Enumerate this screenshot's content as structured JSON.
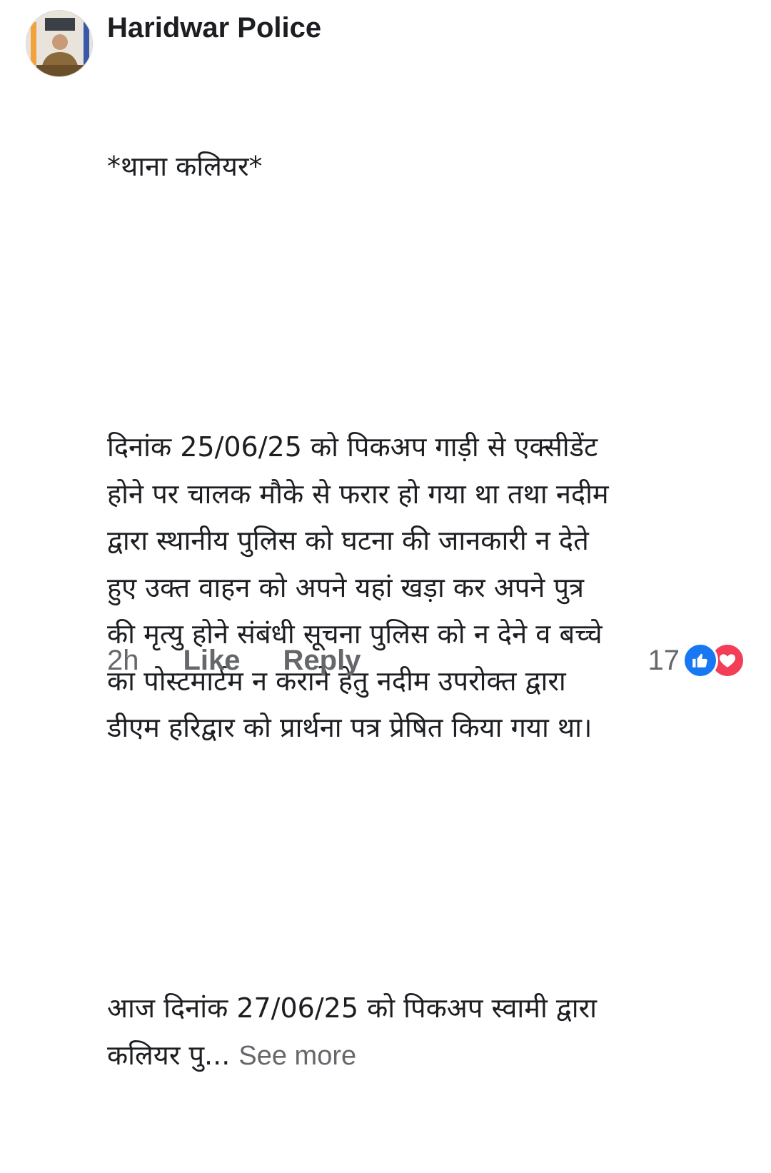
{
  "comment": {
    "author": "Haridwar Police",
    "paragraphs": [
      "*थाना कलियर*",
      "दिनांक 25/06/25 को पिकअप गाड़ी से एक्सीडेंट\nहोने पर चालक मौके से फरार हो गया था तथा नदीम\nद्वारा स्थानीय पुलिस को घटना की जानकारी न देते\nहुए उक्त वाहन को अपने यहां खड़ा कर अपने पुत्र\nकी मृत्यु होने संबंधी सूचना पुलिस को न देने व बच्चे\nका पोस्टमार्टम न कराने हेतु नदीम उपरोक्त द्वारा\nडीएम हरिद्वार को प्रार्थना पत्र प्रेषित किया गया था।",
      "आज दिनांक 27/06/25 को पिकअप स्वामी द्वारा\nकलियर पु..."
    ],
    "see_more": "See more"
  },
  "actions": {
    "time": "2h",
    "like": "Like",
    "reply": "Reply"
  },
  "reactions": {
    "count": "17",
    "icons": [
      "like-icon",
      "love-icon"
    ],
    "like_color": "#1877f2",
    "love_color": "#f33e58"
  },
  "colors": {
    "text": "#1c1e21",
    "muted": "#65676b"
  }
}
